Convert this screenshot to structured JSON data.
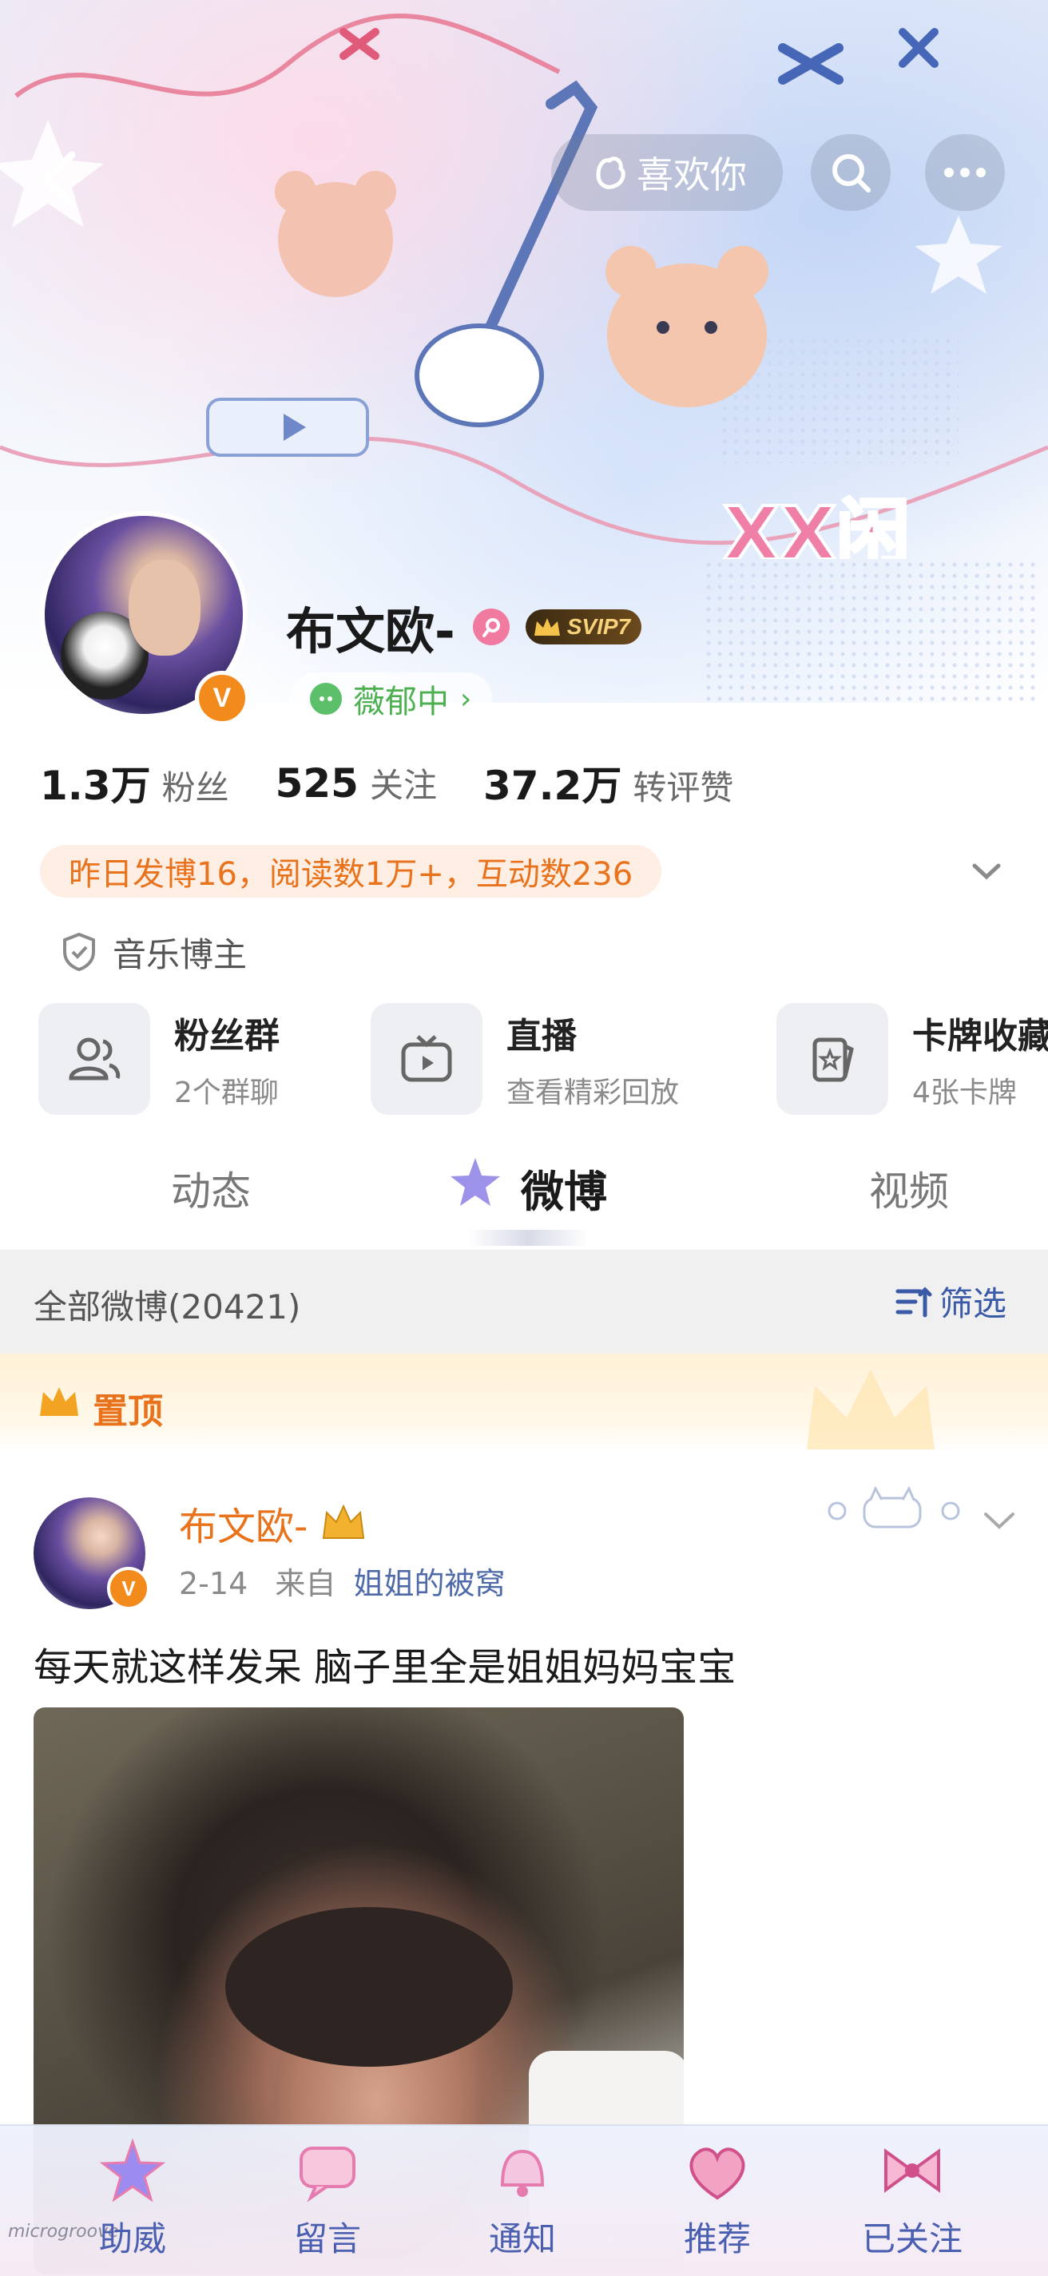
{
  "header": {
    "back_icon": "chevron-left-icon",
    "like_button_label": "喜欢你",
    "search_icon": "search-icon",
    "more_icon": "more-horizontal-icon",
    "banner_text": "XX闲"
  },
  "profile": {
    "name": "布文欧-",
    "gender_icon": "female-icon",
    "vip_badge": "SVIP7",
    "status_label": "薇郁中",
    "verified_badge": "V",
    "stats": [
      {
        "value": "1.3万",
        "label": "粉丝"
      },
      {
        "value": "525",
        "label": "关注"
      },
      {
        "value": "37.2万",
        "label": "转评赞"
      }
    ],
    "summary": "昨日发博16，阅读数1万+，互动数236",
    "category": "音乐博主"
  },
  "quick_links": [
    {
      "icon": "fans-group-icon",
      "title": "粉丝群",
      "subtitle": "2个群聊"
    },
    {
      "icon": "tv-icon",
      "title": "直播",
      "subtitle": "查看精彩回放"
    },
    {
      "icon": "card-icon",
      "title": "卡牌收藏",
      "subtitle": "4张卡牌"
    }
  ],
  "tabs": [
    {
      "label": "动态",
      "active": false
    },
    {
      "label": "微博",
      "active": true
    },
    {
      "label": "视频",
      "active": false
    }
  ],
  "filter": {
    "all_posts_label": "全部微博(20421)",
    "filter_label": "筛选"
  },
  "pinned": {
    "label": "置顶"
  },
  "post": {
    "author": "布文欧-",
    "date": "2-14",
    "source_prefix": "来自",
    "source": "姐姐的被窝",
    "text": "每天就这样发呆 脑子里全是姐姐妈妈宝宝"
  },
  "bottom_nav": [
    {
      "label": "助威"
    },
    {
      "label": "留言"
    },
    {
      "label": "通知"
    },
    {
      "label": "推荐"
    },
    {
      "label": "已关注"
    }
  ],
  "watermark": "microgroove",
  "colors": {
    "accent_orange": "#e8731c",
    "link_blue": "#4e6aa8",
    "nav_blue": "#4a5fb0",
    "status_green": "#4caf50"
  }
}
